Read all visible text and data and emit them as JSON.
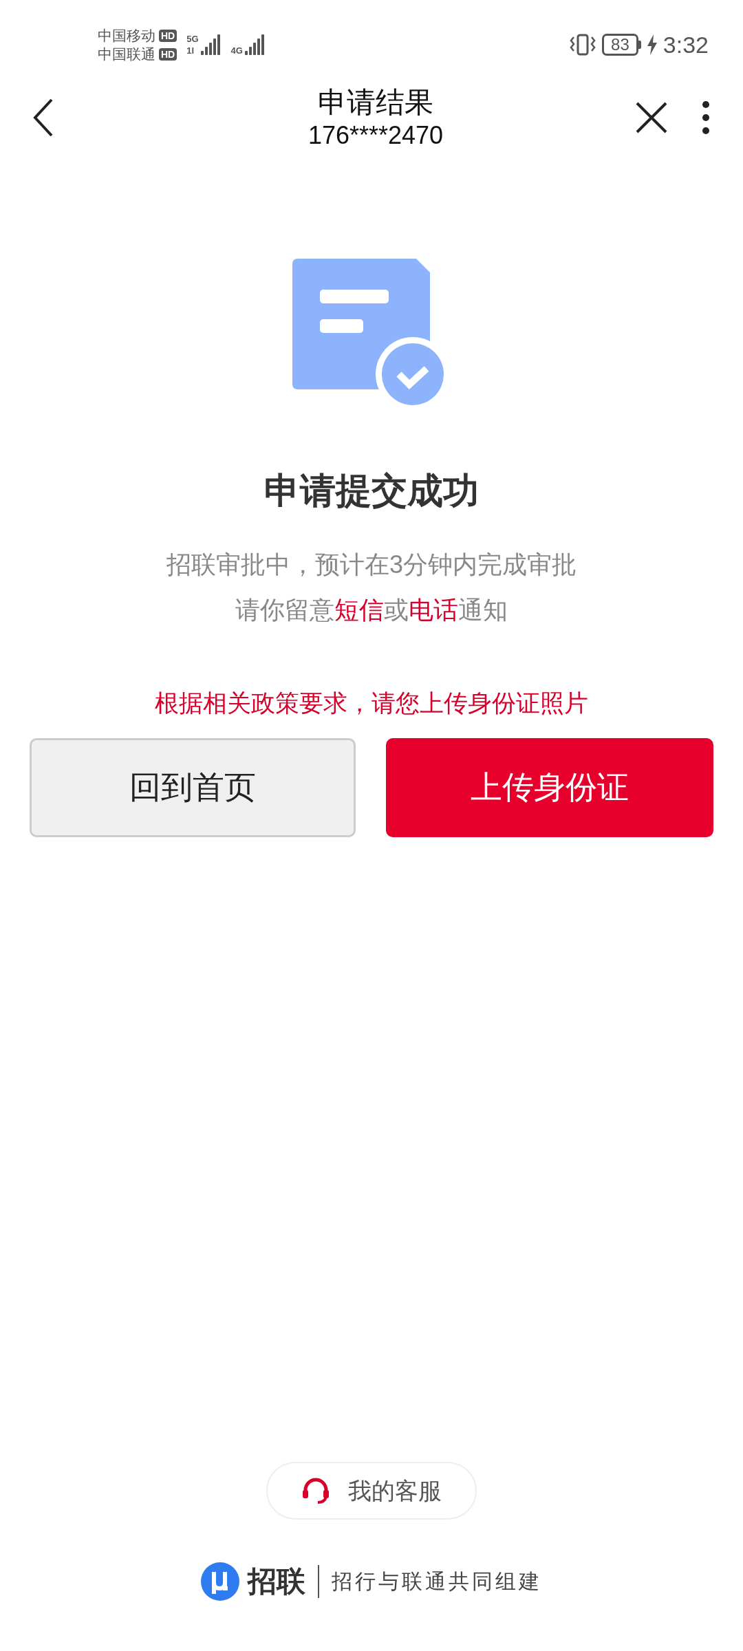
{
  "status_bar": {
    "carriers": [
      {
        "name": "中国移动",
        "badge": "HD"
      },
      {
        "name": "中国联通",
        "badge": "HD"
      }
    ],
    "networks": [
      {
        "top": "5G",
        "bottom": "1l"
      },
      {
        "top": "4G"
      }
    ],
    "battery": "83",
    "charging": true,
    "time": "3:32"
  },
  "header": {
    "title": "申请结果",
    "subtitle": "176****2470"
  },
  "result": {
    "title": "申请提交成功",
    "lines": [
      [
        {
          "text": "招联审批中，预计在3分钟内完成审批",
          "highlight": false
        }
      ],
      [
        {
          "text": "请你留意",
          "highlight": false
        },
        {
          "text": "短信",
          "highlight": true
        },
        {
          "text": "或",
          "highlight": false
        },
        {
          "text": "电话",
          "highlight": true
        },
        {
          "text": "通知",
          "highlight": false
        }
      ]
    ],
    "notice": "根据相关政策要求，请您上传身份证照片"
  },
  "buttons": [
    {
      "label": "回到首页",
      "kind": "secondary"
    },
    {
      "label": "上传身份证",
      "kind": "primary"
    }
  ],
  "service": {
    "label": "我的客服"
  },
  "footer": {
    "brand": "招联",
    "tagline": "招行与联通共同组建"
  }
}
